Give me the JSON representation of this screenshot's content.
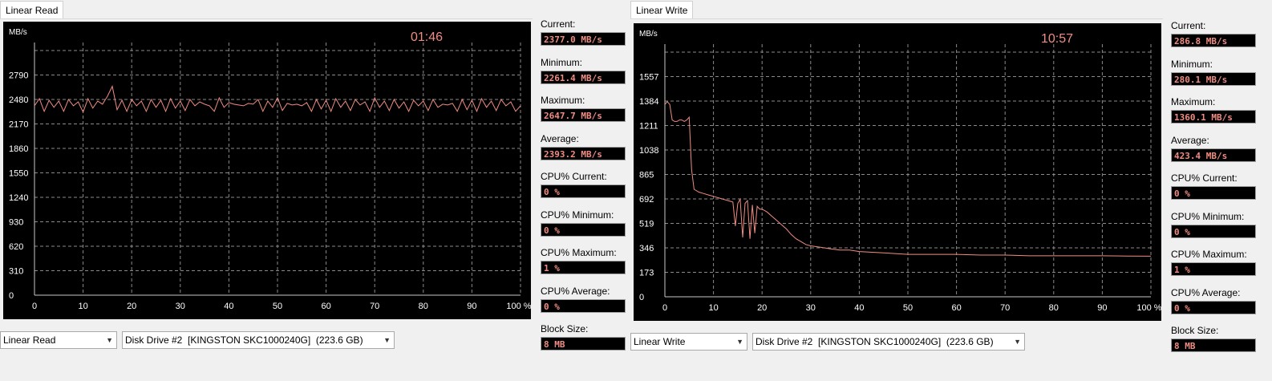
{
  "panels": [
    {
      "tab_label": "Linear Read",
      "timer": "01:46",
      "y_unit": "MB/s",
      "y_ticks": [
        "0",
        "310",
        "620",
        "930",
        "1240",
        "1550",
        "1860",
        "2170",
        "2480",
        "2790"
      ],
      "x_ticks": [
        "0",
        "10",
        "20",
        "30",
        "40",
        "50",
        "60",
        "70",
        "80",
        "90",
        "100 %"
      ],
      "stats": [
        {
          "label": "Current:",
          "value": "2377.0 MB/s"
        },
        {
          "label": "Minimum:",
          "value": "2261.4 MB/s"
        },
        {
          "label": "Maximum:",
          "value": "2647.7 MB/s"
        },
        {
          "label": "Average:",
          "value": "2393.2 MB/s"
        },
        {
          "label": "CPU% Current:",
          "value": "0 %"
        },
        {
          "label": "CPU% Minimum:",
          "value": "0 %"
        },
        {
          "label": "CPU% Maximum:",
          "value": "1 %"
        },
        {
          "label": "CPU% Average:",
          "value": "0 %"
        },
        {
          "label": "Block Size:",
          "value": "8 MB"
        }
      ],
      "mode_select": "Linear Read",
      "drive_select": "Disk Drive #2  [KINGSTON SKC1000240G]  (223.6 GB)"
    },
    {
      "tab_label": "Linear Write",
      "timer": "10:57",
      "y_unit": "MB/s",
      "y_ticks": [
        "0",
        "173",
        "346",
        "519",
        "692",
        "865",
        "1038",
        "1211",
        "1384",
        "1557"
      ],
      "x_ticks": [
        "0",
        "10",
        "20",
        "30",
        "40",
        "50",
        "60",
        "70",
        "80",
        "90",
        "100 %"
      ],
      "stats": [
        {
          "label": "Current:",
          "value": "286.8 MB/s"
        },
        {
          "label": "Minimum:",
          "value": "280.1 MB/s"
        },
        {
          "label": "Maximum:",
          "value": "1360.1 MB/s"
        },
        {
          "label": "Average:",
          "value": "423.4 MB/s"
        },
        {
          "label": "CPU% Current:",
          "value": "0 %"
        },
        {
          "label": "CPU% Minimum:",
          "value": "0 %"
        },
        {
          "label": "CPU% Maximum:",
          "value": "1 %"
        },
        {
          "label": "CPU% Average:",
          "value": "0 %"
        },
        {
          "label": "Block Size:",
          "value": "8 MB"
        }
      ],
      "mode_select": "Linear Write",
      "drive_select": "Disk Drive #2  [KINGSTON SKC1000240G]  (223.6 GB)"
    }
  ],
  "chart_data": [
    {
      "type": "line",
      "ylabel": "MB/s",
      "ylim": [
        0,
        3100
      ],
      "xlim": [
        0,
        100
      ],
      "x_ticks": [
        0,
        10,
        20,
        30,
        40,
        50,
        60,
        70,
        80,
        90,
        100
      ],
      "y_ticks": [
        0,
        310,
        620,
        930,
        1240,
        1550,
        1860,
        2170,
        2480,
        2790
      ],
      "grid": true,
      "line_color": "#f08c82",
      "series": [
        {
          "x": [
            0,
            1,
            2,
            3,
            4,
            5,
            6,
            7,
            8,
            9,
            10,
            11,
            12,
            13,
            14,
            15,
            16,
            17,
            18,
            19,
            20,
            21,
            22,
            23,
            24,
            25,
            26,
            27,
            28,
            29,
            30,
            31,
            32,
            33,
            34,
            35,
            36,
            37,
            38,
            39,
            40,
            41,
            42,
            43,
            44,
            45,
            46,
            47,
            48,
            49,
            50,
            51,
            52,
            53,
            54,
            55,
            56,
            57,
            58,
            59,
            60,
            61,
            62,
            63,
            64,
            65,
            66,
            67,
            68,
            69,
            70,
            71,
            72,
            73,
            74,
            75,
            76,
            77,
            78,
            79,
            80,
            81,
            82,
            83,
            84,
            85,
            86,
            87,
            88,
            89,
            90,
            91,
            92,
            93,
            94,
            95,
            96,
            97,
            98,
            99,
            100
          ],
          "values": [
            2400,
            2490,
            2330,
            2470,
            2380,
            2460,
            2330,
            2480,
            2400,
            2450,
            2320,
            2490,
            2370,
            2460,
            2420,
            2520,
            2647,
            2350,
            2470,
            2330,
            2480,
            2400,
            2460,
            2330,
            2480,
            2380,
            2470,
            2330,
            2490,
            2370,
            2460,
            2340,
            2480,
            2400,
            2450,
            2420,
            2400,
            2330,
            2500,
            2380,
            2440,
            2420,
            2410,
            2400,
            2430,
            2420,
            2480,
            2330,
            2460,
            2380,
            2500,
            2340,
            2430,
            2410,
            2420,
            2400,
            2440,
            2330,
            2480,
            2360,
            2470,
            2330,
            2490,
            2380,
            2460,
            2340,
            2480,
            2410,
            2450,
            2330,
            2500,
            2380,
            2460,
            2340,
            2480,
            2370,
            2450,
            2330,
            2470,
            2400,
            2460,
            2340,
            2480,
            2380,
            2420,
            2410,
            2430,
            2330,
            2480,
            2350,
            2470,
            2330,
            2490,
            2380,
            2460,
            2340,
            2480,
            2400,
            2450,
            2330,
            2400
          ]
        }
      ]
    },
    {
      "type": "line",
      "ylabel": "MB/s",
      "ylim": [
        0,
        1730
      ],
      "xlim": [
        0,
        100
      ],
      "x_ticks": [
        0,
        10,
        20,
        30,
        40,
        50,
        60,
        70,
        80,
        90,
        100
      ],
      "y_ticks": [
        0,
        173,
        346,
        519,
        692,
        865,
        1038,
        1211,
        1384,
        1557
      ],
      "grid": true,
      "line_color": "#f08c82",
      "series": [
        {
          "x": [
            0,
            0.5,
            1,
            1.5,
            2,
            2.5,
            3,
            3.5,
            4,
            4.5,
            5,
            5.5,
            6,
            7,
            8,
            9,
            10,
            11,
            12,
            13,
            14,
            14.5,
            15,
            15.5,
            16,
            16.5,
            17,
            17.5,
            18,
            18.5,
            19,
            19.5,
            20,
            21,
            22,
            23,
            24,
            25,
            26,
            27,
            28,
            29,
            30,
            32,
            34,
            36,
            38,
            40,
            45,
            50,
            55,
            60,
            65,
            70,
            75,
            80,
            85,
            90,
            95,
            100
          ],
          "values": [
            1360,
            1380,
            1360,
            1250,
            1240,
            1240,
            1250,
            1250,
            1240,
            1250,
            1270,
            900,
            760,
            740,
            730,
            720,
            710,
            700,
            690,
            680,
            670,
            500,
            660,
            690,
            420,
            660,
            680,
            410,
            650,
            450,
            640,
            620,
            620,
            600,
            570,
            540,
            510,
            480,
            440,
            410,
            390,
            370,
            360,
            350,
            340,
            330,
            330,
            320,
            310,
            300,
            300,
            300,
            295,
            295,
            290,
            290,
            290,
            290,
            288,
            287
          ]
        }
      ]
    }
  ]
}
